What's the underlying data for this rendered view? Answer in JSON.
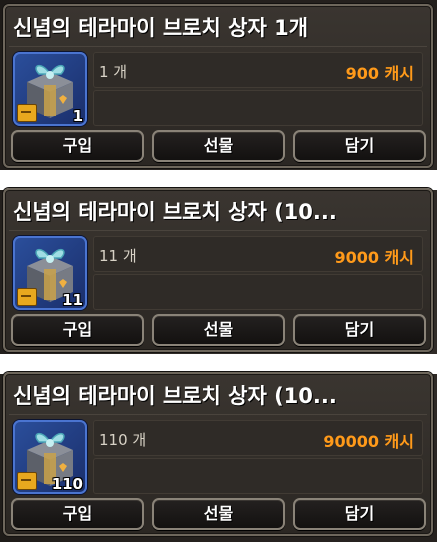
{
  "cards": [
    {
      "title": "신념의 테라마이 브로치 상자 1개",
      "count_label": "1 개",
      "price_label": "900 캐시",
      "badge": "1",
      "buttons": {
        "buy": "구입",
        "gift": "선물",
        "cart": "담기"
      }
    },
    {
      "title": "신념의 테라마이 브로치 상자 (10...",
      "count_label": "11 개",
      "price_label": "9000 캐시",
      "badge": "11",
      "buttons": {
        "buy": "구입",
        "gift": "선물",
        "cart": "담기"
      }
    },
    {
      "title": "신념의 테라마이 브로치 상자 (10...",
      "count_label": "110 개",
      "price_label": "90000 캐시",
      "badge": "110",
      "buttons": {
        "buy": "구입",
        "gift": "선물",
        "cart": "담기"
      }
    }
  ],
  "colors": {
    "price": "#ff9a1a",
    "title": "#ffffff",
    "border": "#6e675c"
  },
  "icon": "gift-box-icon"
}
